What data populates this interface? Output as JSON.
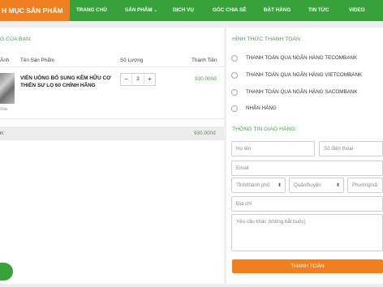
{
  "nav": {
    "category": "H MỤC SẢN PHẨM",
    "items": [
      "TRANG CHỦ",
      "SẢN PHẨM",
      "DỊCH VỤ",
      "GÓC CHIA SẺ",
      "ĐẶT HÀNG",
      "TIN TỨC",
      "VIDEO"
    ],
    "caret": "⌄"
  },
  "cart": {
    "title": "G CỦA BẠN:",
    "headers": {
      "image": "Ảnh",
      "name": "Tên Sản Phẩm",
      "qty": "Số Lượng",
      "price": "Thành Tiền"
    },
    "item": {
      "thumb_caption": "Xóa",
      "name": "VIÊN UỐNG BỔ SUNG KẼM HỮU CƠ THIÊN SƯ LỌ 60 CHÍNH HÃNG",
      "minus": "−",
      "qty": "3",
      "plus": "+",
      "price": "930.000đ"
    },
    "total_label": "n:",
    "total_value": "930.000đ"
  },
  "payment": {
    "title": "HÌNH THỨC THANH TOÁN:",
    "options": [
      "THANH TOÁN QUA NGÂN HÀNG TECOMBANK",
      "THANH TOÁN QUA NGÂN HÀNG VIETCOMBANK",
      "THANH TOÁN QUA NGÂN HÀNG SACOMBANK",
      "NHẬN HÀNG"
    ]
  },
  "shipping": {
    "title": "THÔNG TIN GIAO HÀNG:",
    "fullname_placeholder": "Họ tên",
    "phone_placeholder": "Số điện thoại",
    "email_placeholder": "Email",
    "province": "Tỉnh/thành phố",
    "district": "Quận/huyện",
    "ward": "Phường/xã",
    "address_placeholder": "Địa chỉ",
    "note_placeholder": "Yêu cầu khác (không bắt buộc)",
    "select_arrow": "⬍"
  },
  "submit_label": "THANH TOÁN",
  "colors": {
    "nav": "#37a23a",
    "accent": "#f07f1f",
    "green_text": "#4aa147"
  }
}
